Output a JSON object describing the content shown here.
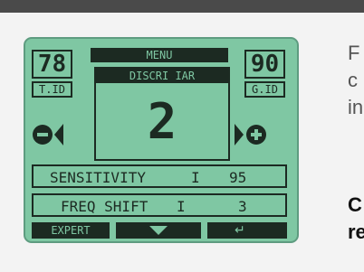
{
  "display": {
    "menu_label": "MENU",
    "mode_label": "DISCRI IAR",
    "mode_value": "2",
    "tid_value": "78",
    "tid_label": "T.ID",
    "gid_value": "90",
    "gid_label": "G.ID",
    "sensitivity_label": "SENSITIVITY",
    "sensitivity_value": "95",
    "freq_label": "FREQ SHIFT",
    "freq_value": "3",
    "expert_label": "EXPERT",
    "colors": {
      "lcd": "#7fc7a3",
      "ink": "#1c2a22"
    }
  },
  "side_text": {
    "line1": "F",
    "line2": "c",
    "line3": "in",
    "bold1": "C",
    "bold2": "re"
  }
}
